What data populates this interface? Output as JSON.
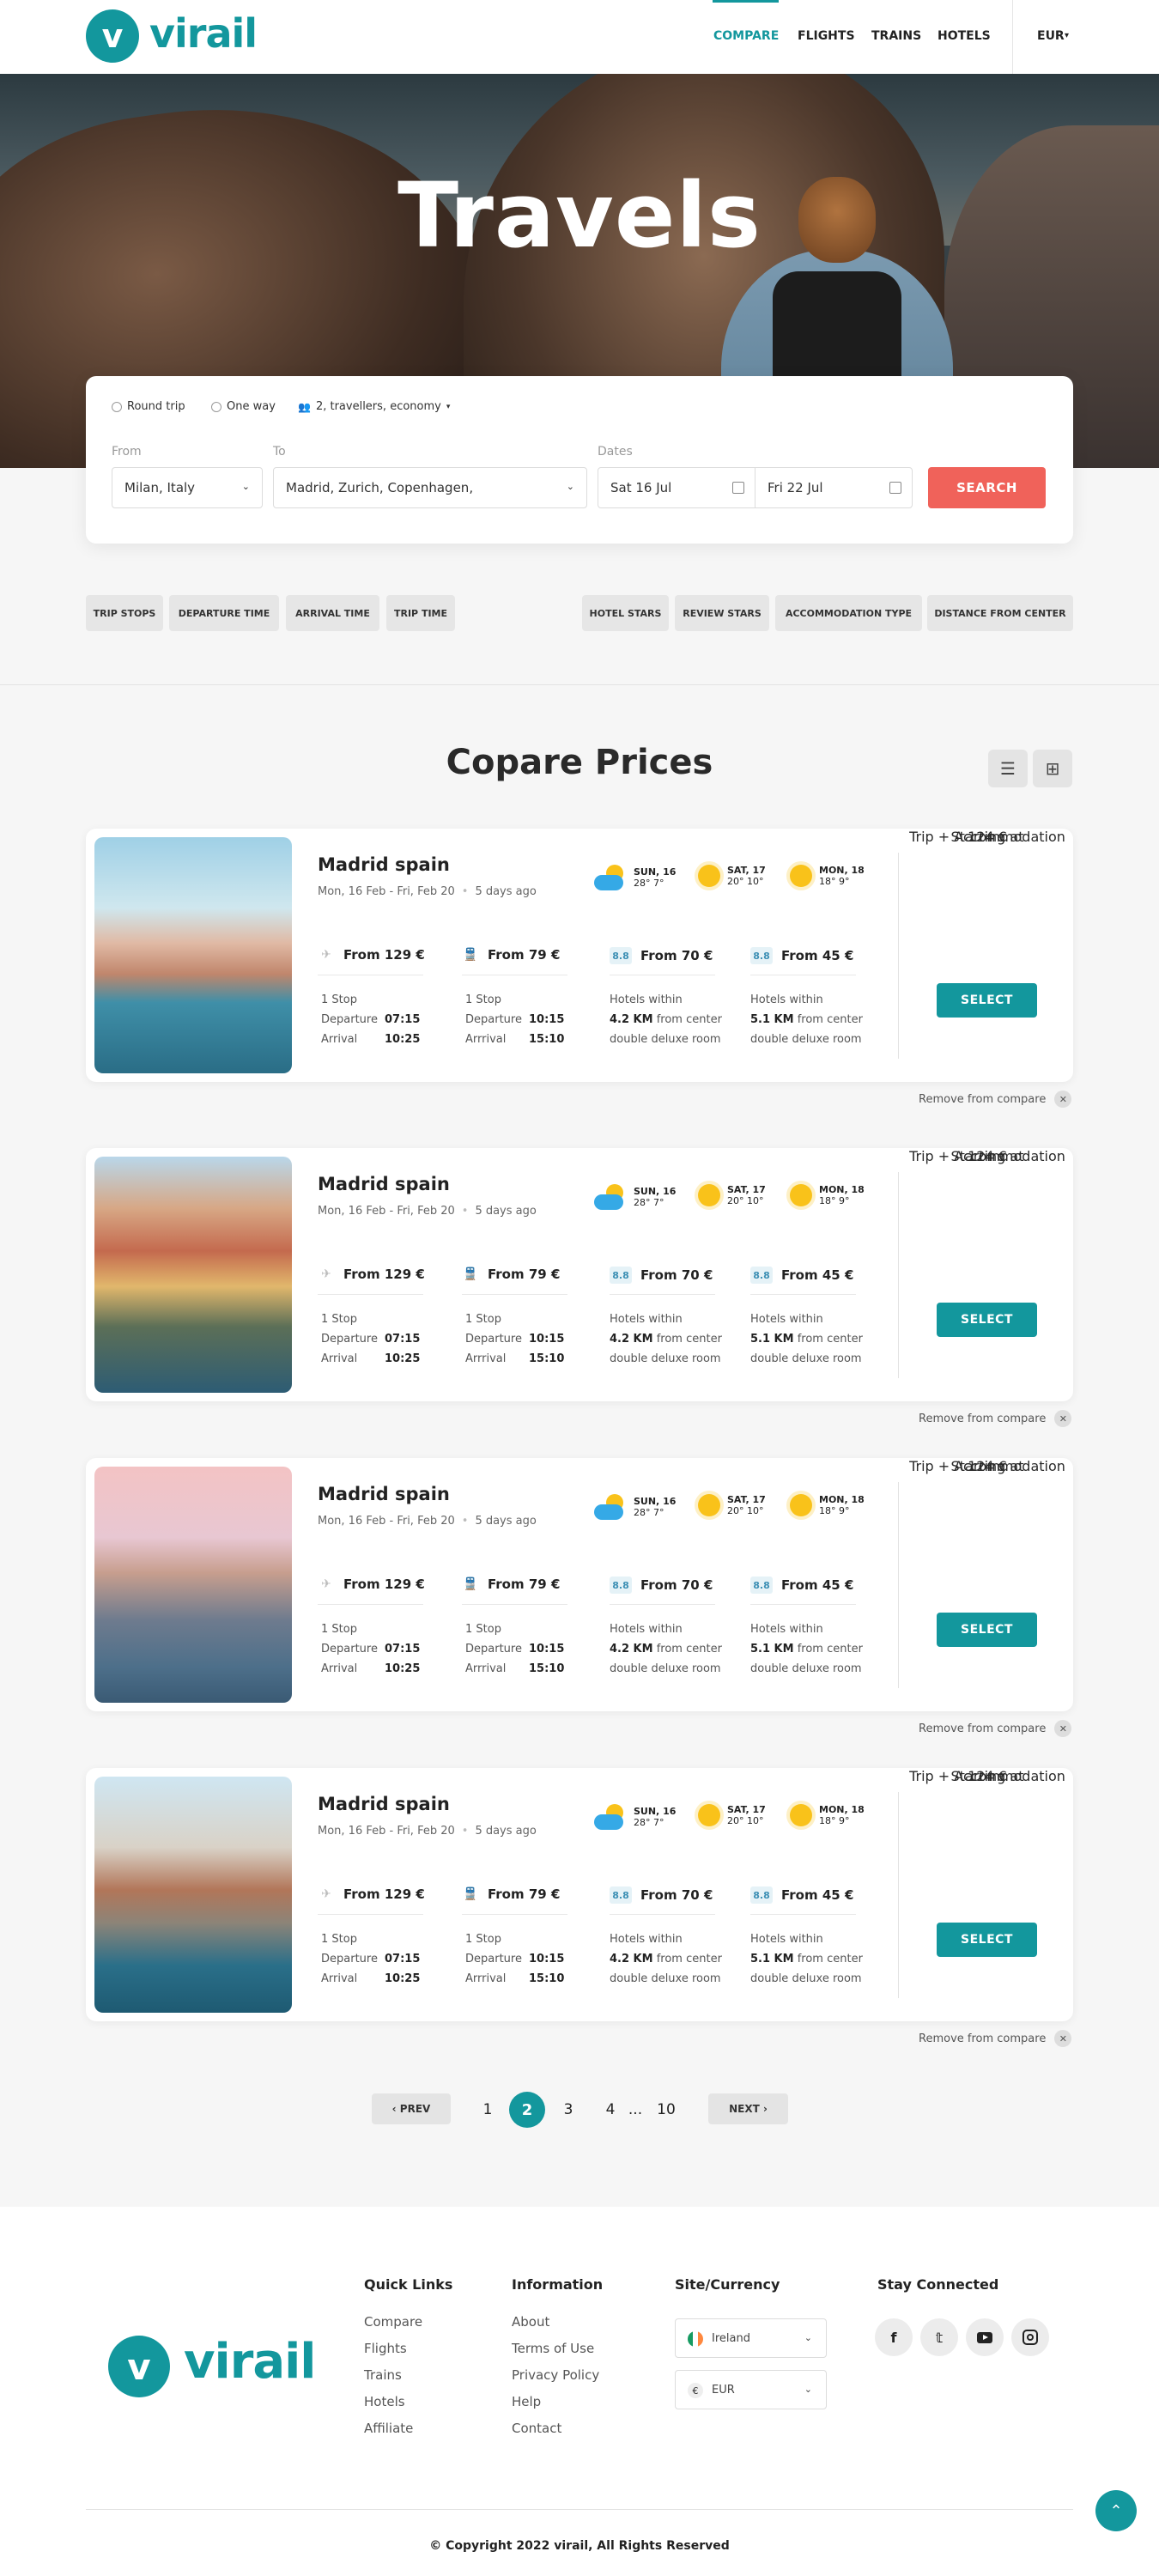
{
  "brand": {
    "letter": "v",
    "name": "virail",
    "accent": "#13979d",
    "cta": "#f0625a"
  },
  "nav": {
    "items": [
      "COMPARE",
      "FLIGHTS",
      "TRAINS",
      "HOTELS"
    ],
    "active": "COMPARE",
    "currency": "EUR"
  },
  "hero": {
    "title": "Travels"
  },
  "search": {
    "trip_types": [
      "Round trip",
      "One way"
    ],
    "travellers": "2, travellers, economy",
    "from_label": "From",
    "from_value": "Milan, Italy",
    "to_label": "To",
    "to_value": "Madrid, Zurich, Copenhagen,",
    "dates_label": "Dates",
    "date_start": "Sat 16 Jul",
    "date_end": "Fri 22 Jul",
    "button": "SEARCH"
  },
  "filters": {
    "left": [
      "TRIP STOPS",
      "DEPARTURE TIME",
      "ARRIVAL TIME",
      "TRIP TIME"
    ],
    "right": [
      "HOTEL STARS",
      "REVIEW STARS",
      "ACCOMMODATION TYPE",
      "DISTANCE FROM CENTER"
    ]
  },
  "compare": {
    "title": "Copare Prices"
  },
  "results": [
    {
      "title": "Madrid spain",
      "dates": "Mon, 16 Feb - Fri, Feb 20",
      "ago": "5 days ago",
      "weather": [
        {
          "day": "SUN, 16",
          "temp": "28° 7°",
          "icon": "cloud-sun-icon"
        },
        {
          "day": "SAT, 17",
          "temp": "20° 10°",
          "icon": "sun-icon"
        },
        {
          "day": "MON, 18",
          "temp": "18° 9°",
          "icon": "sun-icon"
        }
      ],
      "flight": {
        "price": "From 129 €",
        "stops": "1 Stop",
        "dep_label": "Departure",
        "dep": "07:15",
        "arr_label": "Arrival",
        "arr": "10:25"
      },
      "train": {
        "price": "From 79 €",
        "stops": "1 Stop",
        "dep_label": "Departure",
        "dep": "10:15",
        "arr_label": "Arrrival",
        "arr": "15:10"
      },
      "hotel1": {
        "rating": "8.8",
        "price": "From 70 €",
        "l1": "Hotels within",
        "dist": "4.2 KM",
        "from": "from center",
        "room": "double deluxe room"
      },
      "hotel2": {
        "rating": "8.8",
        "price": "From 45 €",
        "l1": "Hotels within",
        "dist": "5.1 KM",
        "from": "from center",
        "room": "double deluxe room"
      },
      "starting": "Starting at",
      "total": "124 €",
      "total_sub": "Trip + Accommodation",
      "select": "SELECT",
      "remove": "Remove from compare"
    },
    {
      "title": "Madrid spain",
      "dates": "Mon, 16 Feb - Fri, Feb 20",
      "ago": "5 days ago",
      "weather": [
        {
          "day": "SUN, 16",
          "temp": "28° 7°",
          "icon": "cloud-sun-icon"
        },
        {
          "day": "SAT, 17",
          "temp": "20° 10°",
          "icon": "sun-icon"
        },
        {
          "day": "MON, 18",
          "temp": "18° 9°",
          "icon": "sun-icon"
        }
      ],
      "flight": {
        "price": "From 129 €",
        "stops": "1 Stop",
        "dep_label": "Departure",
        "dep": "07:15",
        "arr_label": "Arrival",
        "arr": "10:25"
      },
      "train": {
        "price": "From 79 €",
        "stops": "1 Stop",
        "dep_label": "Departure",
        "dep": "10:15",
        "arr_label": "Arrrival",
        "arr": "15:10"
      },
      "hotel1": {
        "rating": "8.8",
        "price": "From 70 €",
        "l1": "Hotels within",
        "dist": "4.2 KM",
        "from": "from center",
        "room": "double deluxe room"
      },
      "hotel2": {
        "rating": "8.8",
        "price": "From 45 €",
        "l1": "Hotels within",
        "dist": "5.1 KM",
        "from": "from center",
        "room": "double deluxe room"
      },
      "starting": "Starting at",
      "total": "124 €",
      "total_sub": "Trip + Accommodation",
      "select": "SELECT",
      "remove": "Remove from compare"
    },
    {
      "title": "Madrid spain",
      "dates": "Mon, 16 Feb - Fri, Feb 20",
      "ago": "5 days ago",
      "weather": [
        {
          "day": "SUN, 16",
          "temp": "28° 7°",
          "icon": "cloud-sun-icon"
        },
        {
          "day": "SAT, 17",
          "temp": "20° 10°",
          "icon": "sun-icon"
        },
        {
          "day": "MON, 18",
          "temp": "18° 9°",
          "icon": "sun-icon"
        }
      ],
      "flight": {
        "price": "From 129 €",
        "stops": "1 Stop",
        "dep_label": "Departure",
        "dep": "07:15",
        "arr_label": "Arrival",
        "arr": "10:25"
      },
      "train": {
        "price": "From 79 €",
        "stops": "1 Stop",
        "dep_label": "Departure",
        "dep": "10:15",
        "arr_label": "Arrrival",
        "arr": "15:10"
      },
      "hotel1": {
        "rating": "8.8",
        "price": "From 70 €",
        "l1": "Hotels within",
        "dist": "4.2 KM",
        "from": "from center",
        "room": "double deluxe room"
      },
      "hotel2": {
        "rating": "8.8",
        "price": "From 45 €",
        "l1": "Hotels within",
        "dist": "5.1 KM",
        "from": "from center",
        "room": "double deluxe room"
      },
      "starting": "Starting at",
      "total": "124 €",
      "total_sub": "Trip + Accommodation",
      "select": "SELECT",
      "remove": "Remove from compare"
    },
    {
      "title": "Madrid spain",
      "dates": "Mon, 16 Feb - Fri, Feb 20",
      "ago": "5 days ago",
      "weather": [
        {
          "day": "SUN, 16",
          "temp": "28° 7°",
          "icon": "cloud-sun-icon"
        },
        {
          "day": "SAT, 17",
          "temp": "20° 10°",
          "icon": "sun-icon"
        },
        {
          "day": "MON, 18",
          "temp": "18° 9°",
          "icon": "sun-icon"
        }
      ],
      "flight": {
        "price": "From 129 €",
        "stops": "1 Stop",
        "dep_label": "Departure",
        "dep": "07:15",
        "arr_label": "Arrival",
        "arr": "10:25"
      },
      "train": {
        "price": "From 79 €",
        "stops": "1 Stop",
        "dep_label": "Departure",
        "dep": "10:15",
        "arr_label": "Arrrival",
        "arr": "15:10"
      },
      "hotel1": {
        "rating": "8.8",
        "price": "From 70 €",
        "l1": "Hotels within",
        "dist": "4.2 KM",
        "from": "from center",
        "room": "double deluxe room"
      },
      "hotel2": {
        "rating": "8.8",
        "price": "From 45 €",
        "l1": "Hotels within",
        "dist": "5.1 KM",
        "from": "from center",
        "room": "double deluxe room"
      },
      "starting": "Starting at",
      "total": "124 €",
      "total_sub": "Trip + Accommodation",
      "select": "SELECT",
      "remove": "Remove from compare"
    }
  ],
  "pagination": {
    "prev": "‹ PREV",
    "pages": [
      "1",
      "2",
      "3",
      "4",
      "...",
      "10"
    ],
    "current": "2",
    "next": "NEXT ›"
  },
  "footer": {
    "quick_links": {
      "title": "Quick Links",
      "items": [
        "Compare",
        "Flights",
        "Trains",
        "Hotels",
        "Affiliate"
      ]
    },
    "information": {
      "title": "Information",
      "items": [
        "About",
        "Terms of Use",
        "Privacy Policy",
        "Help",
        "Contact"
      ]
    },
    "site_currency": {
      "title": "Site/Currency",
      "site": "Ireland",
      "currency": "EUR",
      "currency_symbol": "€"
    },
    "stay_connected": {
      "title": "Stay Connected",
      "icons": [
        "facebook-icon",
        "twitter-icon",
        "youtube-icon",
        "instagram-icon"
      ]
    },
    "copyright": "© Copyright 2022 virail, All Rights Reserved"
  }
}
